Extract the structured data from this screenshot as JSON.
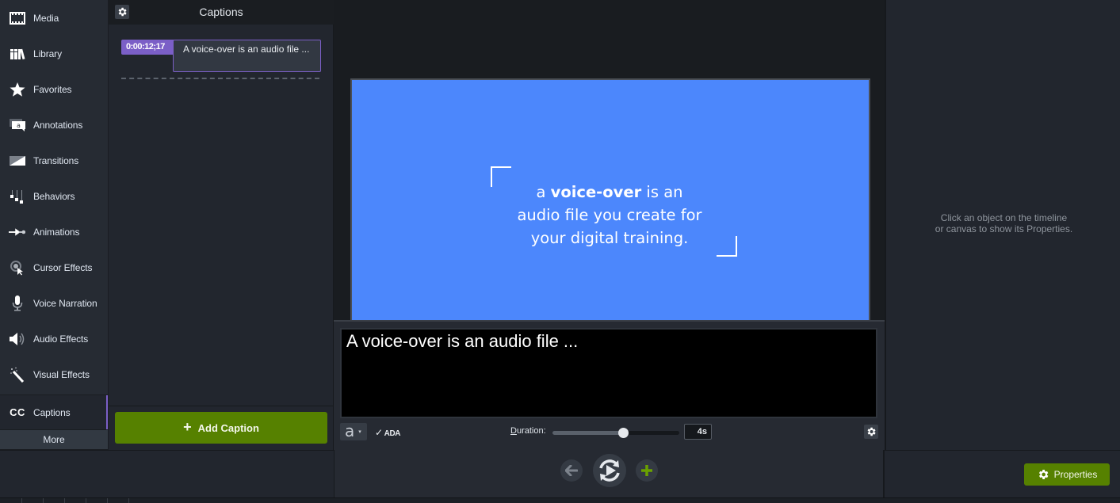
{
  "nav": {
    "items": [
      {
        "label": "Media",
        "icon": "film-icon"
      },
      {
        "label": "Library",
        "icon": "books-icon"
      },
      {
        "label": "Favorites",
        "icon": "star-icon"
      },
      {
        "label": "Annotations",
        "icon": "annotation-icon"
      },
      {
        "label": "Transitions",
        "icon": "transition-icon"
      },
      {
        "label": "Behaviors",
        "icon": "behaviors-icon"
      },
      {
        "label": "Animations",
        "icon": "animation-arrow-icon"
      },
      {
        "label": "Cursor Effects",
        "icon": "cursor-icon"
      },
      {
        "label": "Voice Narration",
        "icon": "microphone-icon"
      },
      {
        "label": "Audio Effects",
        "icon": "speaker-icon"
      },
      {
        "label": "Visual Effects",
        "icon": "magic-wand-icon"
      },
      {
        "label": "Captions",
        "icon": "cc-icon",
        "glyph": "CC",
        "active": true
      }
    ],
    "more_label": "More"
  },
  "captions_panel": {
    "title": "Captions",
    "entries": [
      {
        "timestamp": "0:00:12;17",
        "text": "A voice-over is an audio file ..."
      }
    ],
    "add_button_label": "Add Caption",
    "add_button_icon": "+"
  },
  "canvas": {
    "background_color": "#4c87fc",
    "slide_text_pre": "a ",
    "slide_text_bold": "voice-over",
    "slide_text_line1_post": " is an",
    "slide_text_line2": "audio file you create for",
    "slide_text_line3": "your digital training."
  },
  "editor": {
    "caption_text": "A voice-over is an audio file ...",
    "font_button_glyph": "a",
    "font_caret": "▾",
    "ada_check": "✓",
    "ada_label": "ADA",
    "duration_label_first": "D",
    "duration_label_rest": "uration:",
    "duration_value": "4s",
    "duration_slider_fraction": 0.56
  },
  "properties": {
    "hint_line1": "Click an object on the timeline",
    "hint_line2": "or canvas to show its Properties.",
    "button_label": "Properties"
  },
  "colors": {
    "accent_purple": "#7b5fc7",
    "accent_green": "#568100",
    "canvas_blue": "#4c87fc"
  }
}
